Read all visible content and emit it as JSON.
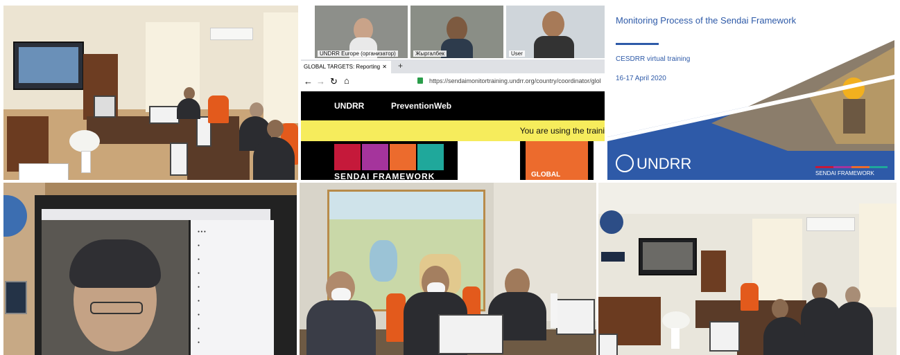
{
  "video_call": {
    "participants": [
      {
        "label": "UNDRR Europe (организатор)"
      },
      {
        "label": "Жыргалбек"
      },
      {
        "label": "User"
      }
    ],
    "browser_tab_title": "GLOBAL TARGETS: Reporting",
    "url": "https://sendaimonitortraining.undrr.org/country/coordinator/glol",
    "nav_links": [
      "UNDRR",
      "PreventionWeb"
    ],
    "banner_text": "You are using the traini",
    "sendai_label": "SENDAI FRAMEWORK",
    "global_label": "GLOBAL",
    "tile_colors": [
      "#c5193a",
      "#a5349c",
      "#ec6b2d",
      "#1fa89b"
    ]
  },
  "slide": {
    "title": "Monitoring Process of the Sendai Framework",
    "subtitle": "CESDRR virtual training",
    "dates": "16-17 April 2020",
    "logo_text": "UNDRR",
    "footer_text": "SENDAI FRAMEWORK",
    "accent_color": "#2e5aa8",
    "stripe_colors": [
      "#c5193a",
      "#a5349c",
      "#ec6b2d",
      "#1fa89b"
    ]
  },
  "photos": {
    "office": "office-with-participants",
    "screen": "video-participant-on-display",
    "meeting": "three-participants-with-map",
    "office2": "participants-at-desks"
  }
}
